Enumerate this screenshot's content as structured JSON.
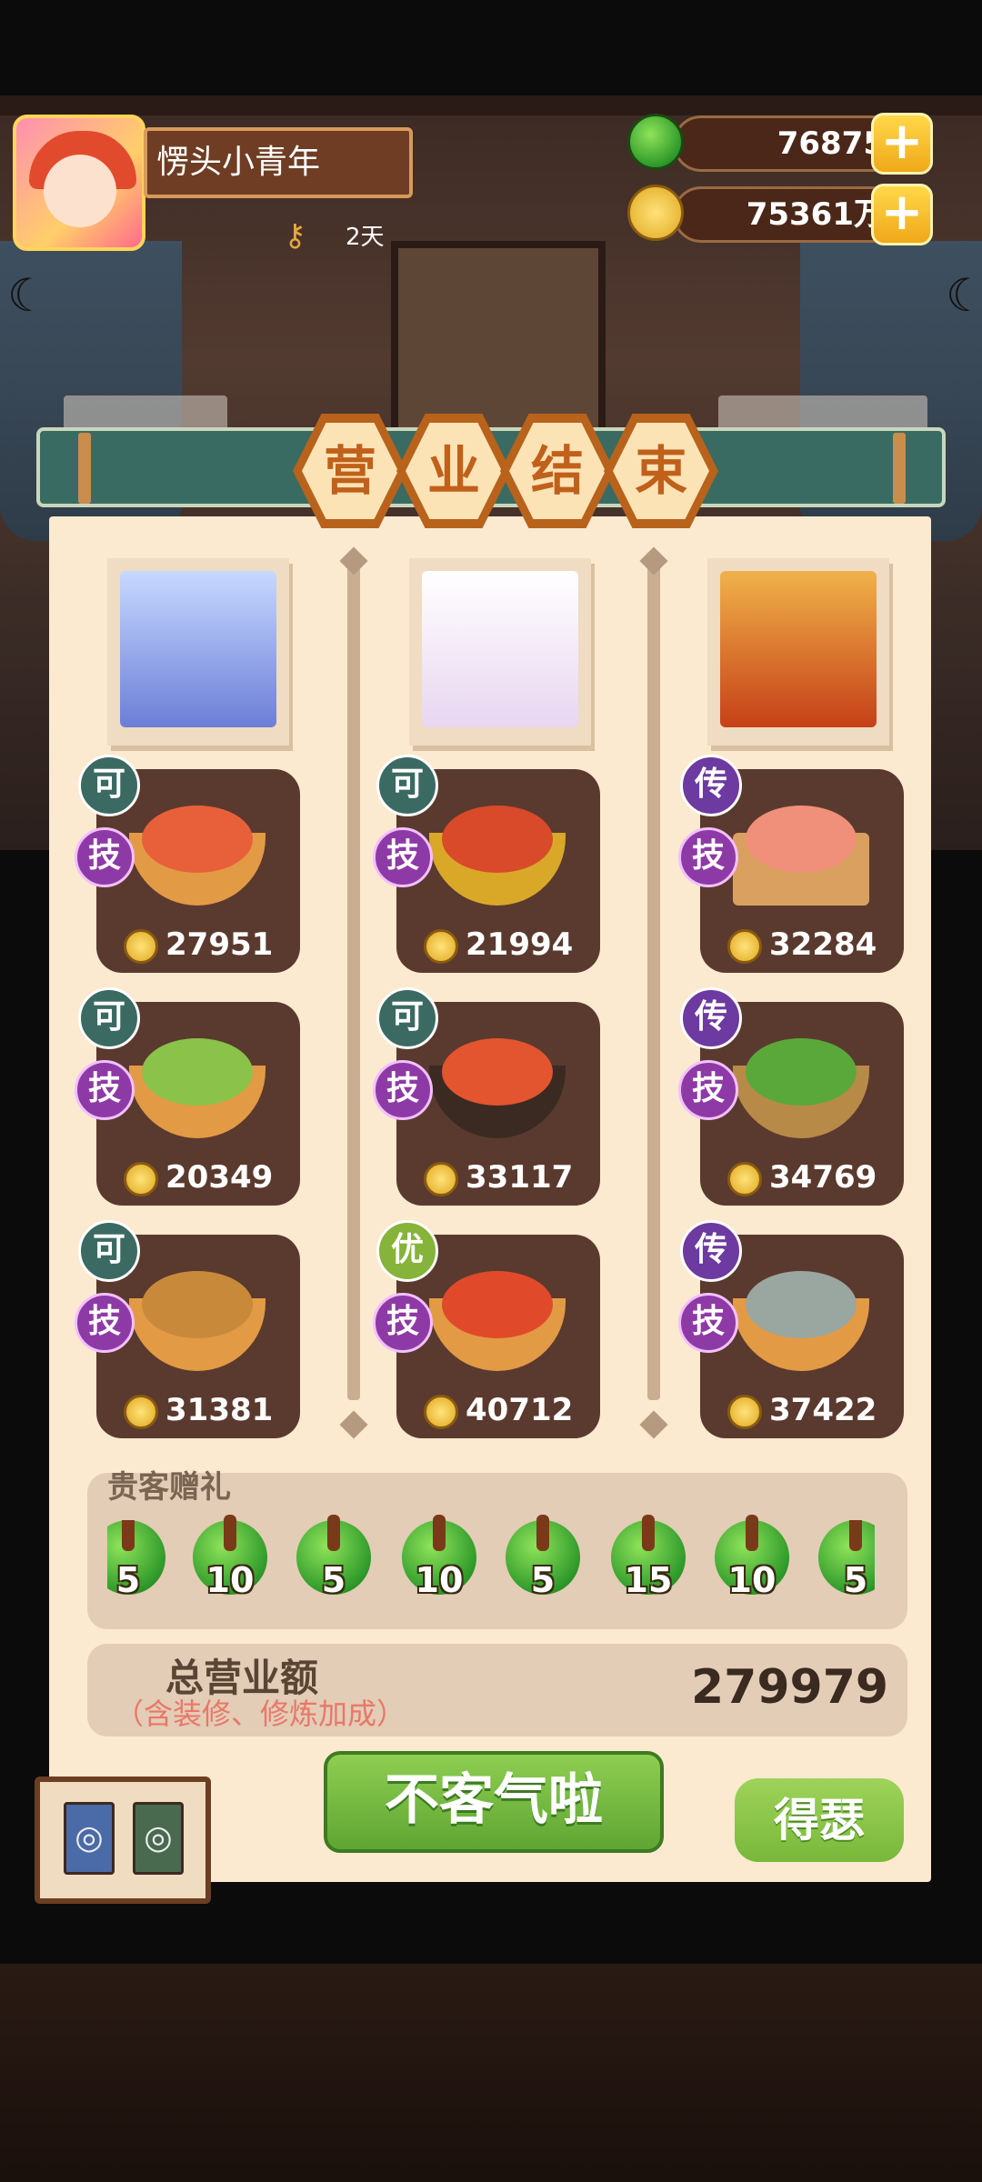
{
  "player": {
    "name": "愣头小青年",
    "days": "2天"
  },
  "currency": {
    "jade": "76875",
    "coins": "75361万"
  },
  "banner": {
    "chars": [
      "营",
      "业",
      "结",
      "束"
    ]
  },
  "columns": [
    {
      "dishes": [
        {
          "grade": "可",
          "skill": "技",
          "value": "27951"
        },
        {
          "grade": "可",
          "skill": "技",
          "value": "20349"
        },
        {
          "grade": "可",
          "skill": "技",
          "value": "31381"
        }
      ]
    },
    {
      "dishes": [
        {
          "grade": "可",
          "skill": "技",
          "value": "21994"
        },
        {
          "grade": "可",
          "skill": "技",
          "value": "33117"
        },
        {
          "grade": "优",
          "skill": "技",
          "value": "40712"
        }
      ]
    },
    {
      "dishes": [
        {
          "grade": "传",
          "skill": "技",
          "value": "32284"
        },
        {
          "grade": "传",
          "skill": "技",
          "value": "34769"
        },
        {
          "grade": "传",
          "skill": "技",
          "value": "37422"
        }
      ]
    }
  ],
  "gifts": {
    "title": "贵客赠礼",
    "amounts": [
      "5",
      "10",
      "5",
      "10",
      "5",
      "15",
      "10",
      "5"
    ]
  },
  "total": {
    "label": "总营业额",
    "note": "（含装修、修炼加成）",
    "value": "279979"
  },
  "buttons": {
    "thanks": "不客气啦",
    "smug": "得瑟"
  },
  "colors": {
    "banner": "#3a6b62",
    "panel": "#fbe9d0",
    "accent_green": "#5ea632",
    "grade_ke": "#3b6a63",
    "grade_chuan": "#6c3aa0",
    "grade_you": "#86b33a"
  },
  "icons": {
    "jade": "jade-coin-icon",
    "coin": "gold-coin-icon",
    "plus": "plus-icon",
    "days": "key-icon"
  }
}
